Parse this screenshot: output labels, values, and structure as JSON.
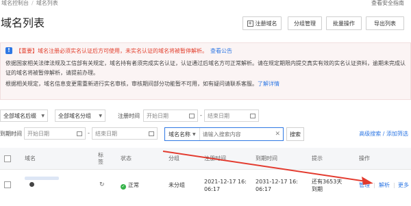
{
  "breadcrumb": {
    "root": "域名控制台",
    "current": "域名列表"
  },
  "help_link": "查看安全指南",
  "page_title": "域名列表",
  "toolbar": {
    "register_label": "注册域名",
    "group_label": "分组管理",
    "ops_label": "批量操作",
    "export_label": "导出列表"
  },
  "notice": {
    "line1": "【重要】域名注册必须实名认证后方可使用，未实名认证的域名将被暂停解析。",
    "line1_link": "查看公告",
    "line2": "依据国家相关法律法规及工信部有关规定，域名持有者须完成实名认证，认证通过后域名方可正常解析。请在规定期限内提交真实有效的实名认证资料，逾期未完成认证的域名将被暂停解析，请提前办理。",
    "line3": "根据相关规定，域名信息变更需重新进行实名审核，审核期间部分功能暂不可用，如有疑问请联系客服。",
    "line3_link": "了解详情"
  },
  "filters": {
    "suffix_select": "全部域名后缀",
    "type_select": "全部域名分组",
    "register_time_label": "注册时间",
    "register_start": "开始日期",
    "register_end": "结束日期",
    "expire_time_label": "到期时间",
    "expire_start": "开始日期",
    "expire_end": "结束日期",
    "search_type": "域名名称",
    "search_placeholder": "请输入搜索内容",
    "search_button": "搜索",
    "advanced_link": "高级搜索 / 添加筛选"
  },
  "table": {
    "columns": {
      "domain": "域名",
      "tag": "标签",
      "status": "状态",
      "group": "分组",
      "register_time": "注册时间",
      "expire_time": "到期时间",
      "tips": "提示",
      "actions": "操作"
    },
    "rows": [
      {
        "status": "正常",
        "group": "未分组",
        "register_date": "2021-12-17 16:",
        "register_time": "06:17",
        "expire_date": "2031-12-17 16:",
        "expire_time": "06:17",
        "tips_line1": "还有3653天",
        "tips_line2": "到期",
        "action_manage": "管理",
        "action_resolve": "解析",
        "action_more": "更多"
      }
    ]
  },
  "colors": {
    "accent": "#2f78e4",
    "notice_red": "#e23d2b",
    "status_green": "#35b34a",
    "arrow_red": "#e33a2e"
  },
  "icons": [
    "info-icon",
    "register-icon",
    "calendar-icon",
    "clear-icon",
    "play-icon",
    "dnssec-icon",
    "status-check-icon",
    "annotation-arrow"
  ]
}
